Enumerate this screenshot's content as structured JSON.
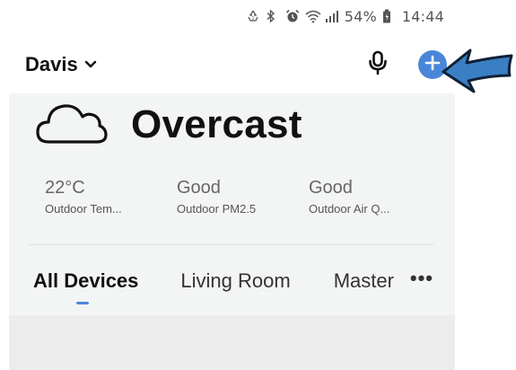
{
  "status_bar": {
    "battery_percent": "54%",
    "time": "14:44"
  },
  "header": {
    "home_name": "Davis"
  },
  "weather": {
    "condition": "Overcast",
    "stats": [
      {
        "value": "22°C",
        "label": "Outdoor Tem..."
      },
      {
        "value": "Good",
        "label": "Outdoor PM2.5"
      },
      {
        "value": "Good",
        "label": "Outdoor Air Q..."
      }
    ]
  },
  "tabs": {
    "items": [
      {
        "label": "All Devices",
        "active": true
      },
      {
        "label": "Living Room",
        "active": false
      },
      {
        "label": "Master",
        "active": false
      }
    ],
    "more_label": "•••"
  },
  "colors": {
    "accent": "#4a86d8",
    "panel_bg": "#f3f4f4",
    "arrow": "#3a7fc4"
  },
  "icons": {
    "status": [
      "recycle-icon",
      "bluetooth-icon",
      "alarm-icon",
      "wifi-icon",
      "signal-icon",
      "battery-icon"
    ],
    "header": [
      "chevron-down-icon",
      "microphone-icon",
      "plus-icon"
    ],
    "weather": "cloud-icon"
  }
}
